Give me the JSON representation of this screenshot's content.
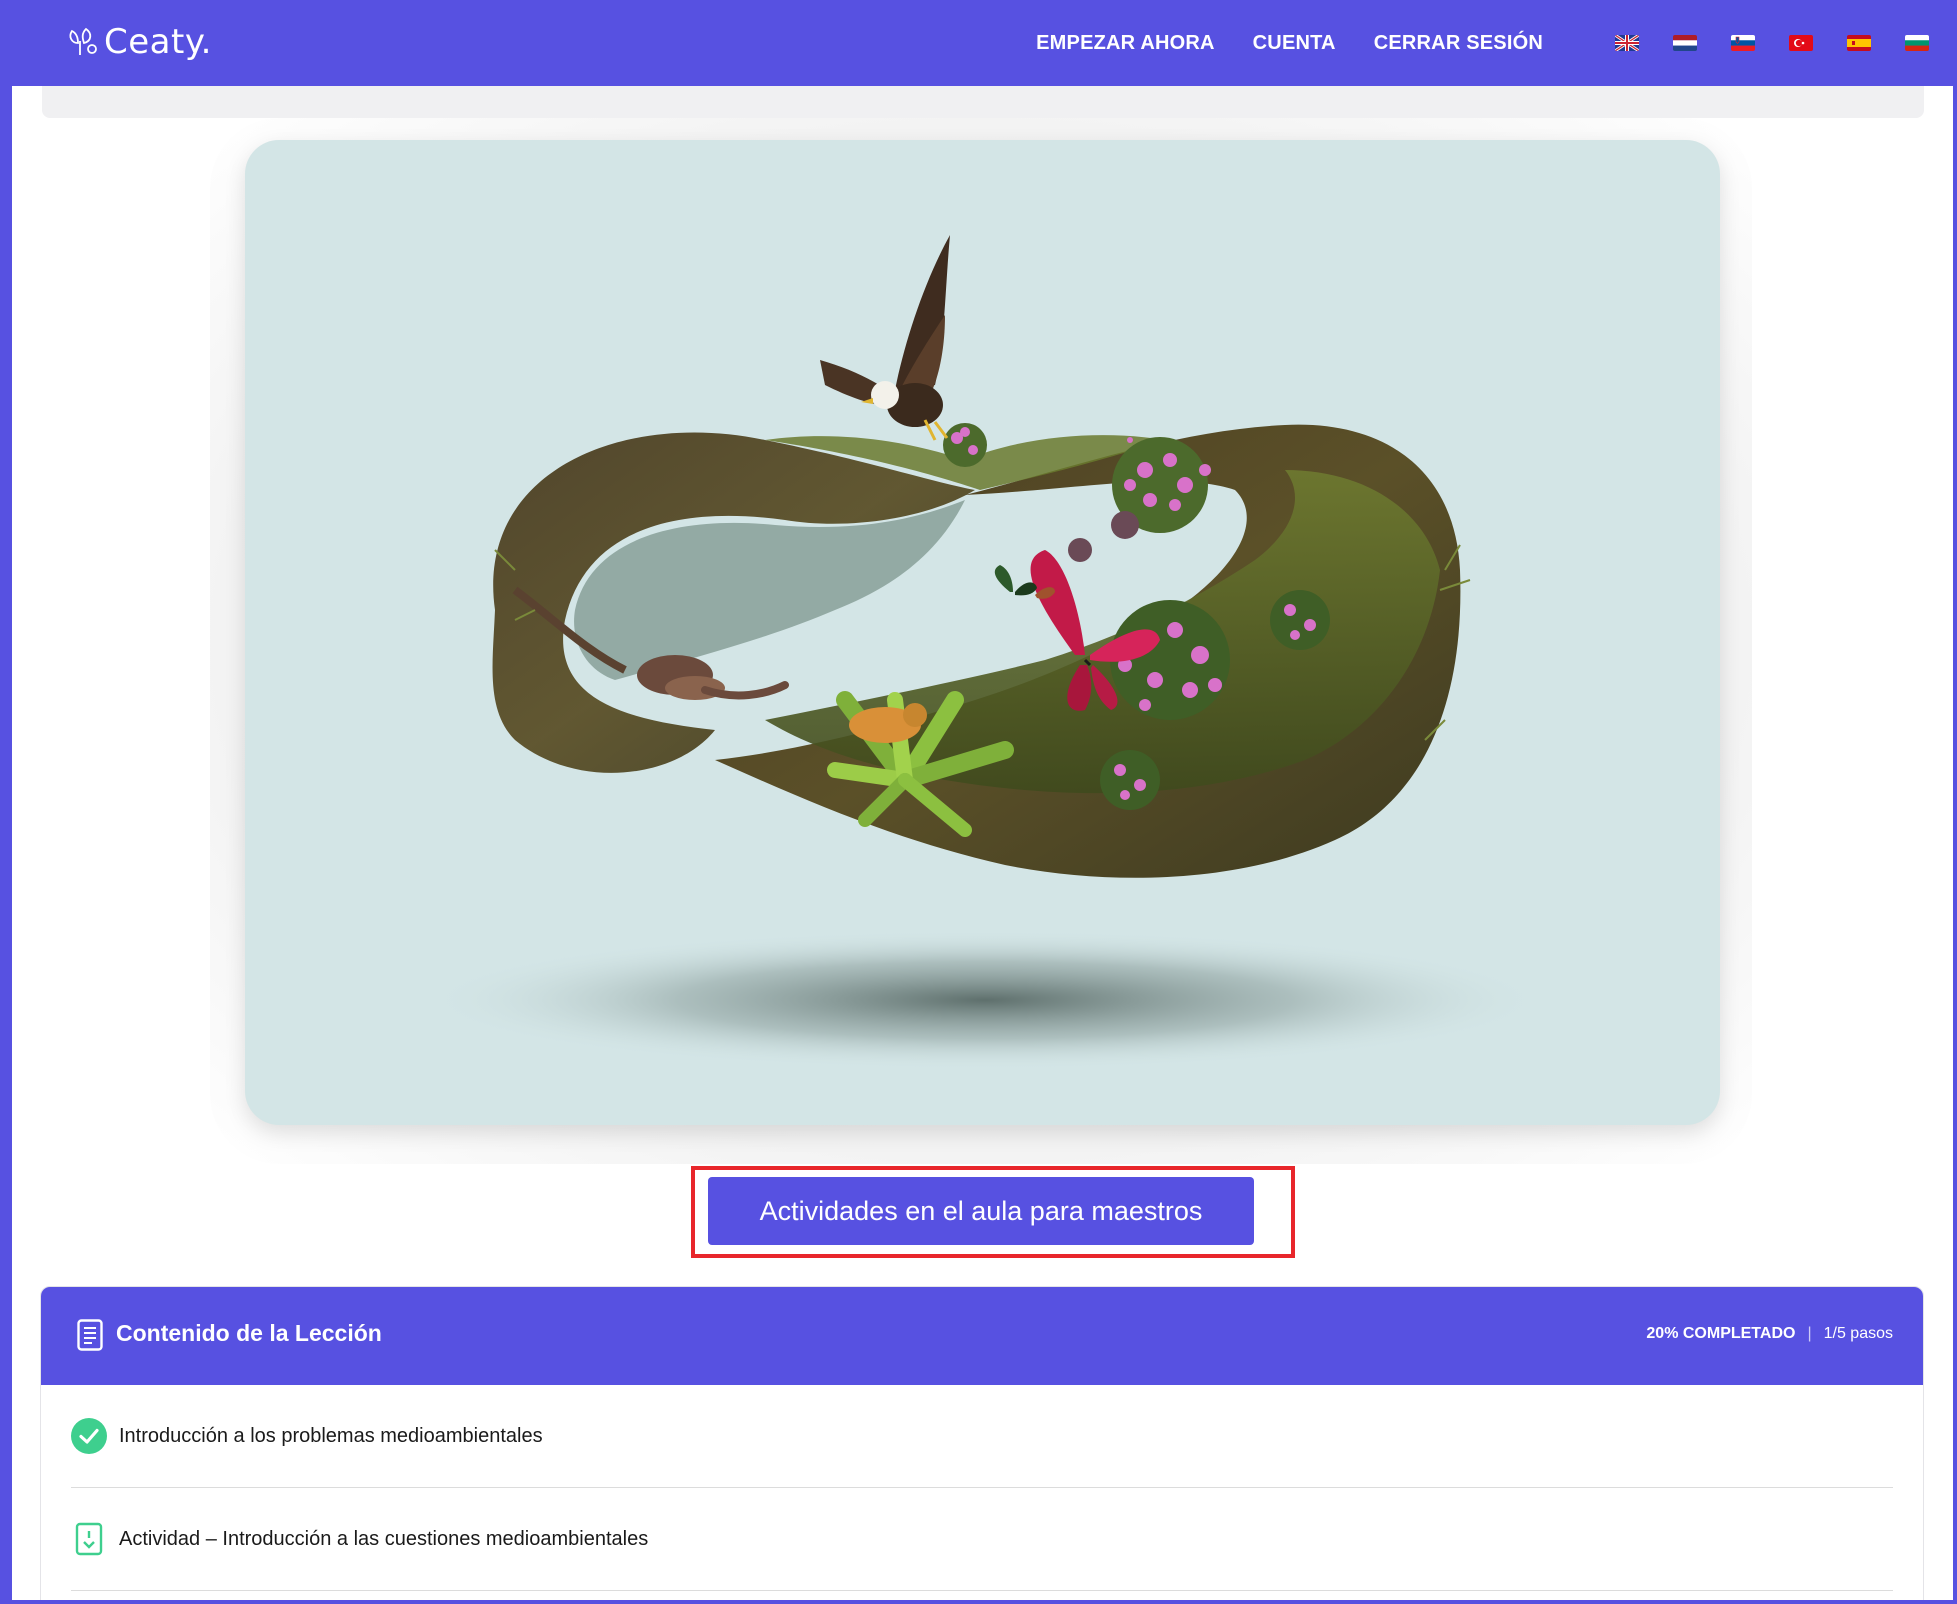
{
  "app": {
    "logo_text": "Ceaty.",
    "logo_icon": "leaf-logo-icon"
  },
  "nav": {
    "links": [
      {
        "label": "EMPEZAR AHORA"
      },
      {
        "label": "CUENTA"
      },
      {
        "label": "CERRAR SESIÓN"
      }
    ],
    "flags": [
      {
        "name": "uk-flag-icon"
      },
      {
        "name": "netherlands-flag-icon"
      },
      {
        "name": "slovenia-flag-icon"
      },
      {
        "name": "turkey-flag-icon"
      },
      {
        "name": "spain-flag-icon"
      },
      {
        "name": "bulgaria-flag-icon"
      }
    ]
  },
  "cta": {
    "label": "Actividades en el aula para maestros"
  },
  "lesson": {
    "title": "Contenido de la Lección",
    "progress_percent": "20% COMPLETADO",
    "separator": "|",
    "steps": "1/5 pasos",
    "items": [
      {
        "label": "Introducción a los problemas medioambientales",
        "status": "completed",
        "icon": "check-circle-icon"
      },
      {
        "label": "Actividad – Introducción a las cuestiones medioambientales",
        "status": "pending",
        "icon": "activity-document-icon"
      }
    ]
  },
  "colors": {
    "brand": "#5751E1",
    "highlight": "#e8262b",
    "completed": "#3ecf8e",
    "hero_bg": "#d3e5e6"
  }
}
